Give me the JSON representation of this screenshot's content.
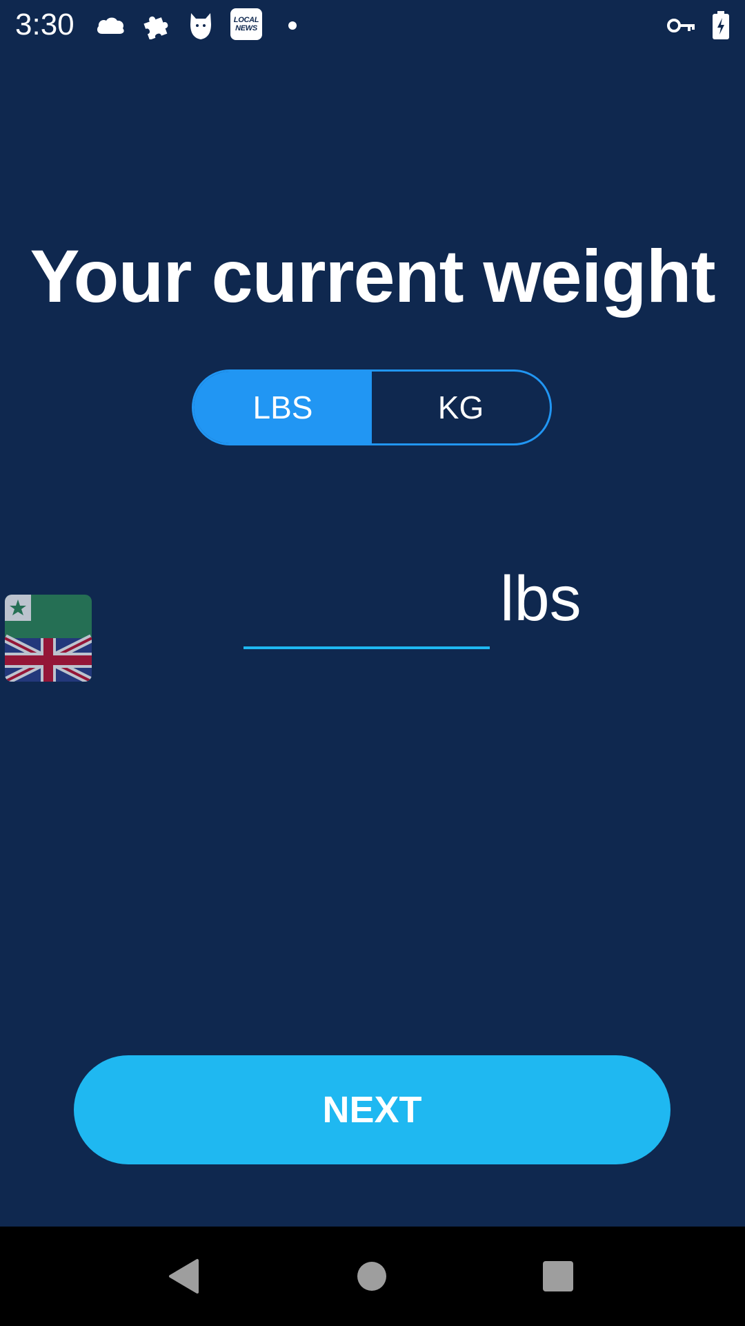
{
  "status_bar": {
    "time": "3:30",
    "left_icons": [
      "cloud-icon",
      "puzzle-icon",
      "cat-icon",
      "local-news-icon",
      "notification-dot"
    ],
    "news_badge": [
      "LOCAL",
      "NEWS"
    ],
    "right_icons": [
      "vpn-key-icon",
      "battery-charging-icon"
    ]
  },
  "main": {
    "title": "Your current weight",
    "unit_toggle": {
      "options": [
        {
          "label": "LBS",
          "selected": true
        },
        {
          "label": "KG",
          "selected": false
        }
      ]
    },
    "weight_input": {
      "value": "",
      "placeholder": "",
      "unit_suffix": "lbs"
    },
    "language_flag": "esperanto-uk-flag-icon",
    "next_label": "NEXT"
  },
  "navigation_bar": {
    "buttons": [
      "back-icon",
      "home-icon",
      "recents-icon"
    ]
  },
  "colors": {
    "background": "#0F284F",
    "accent": "#2196F3",
    "button": "#1FB8F1",
    "nav_bar": "#000000",
    "nav_icons": "#9E9E9E"
  }
}
